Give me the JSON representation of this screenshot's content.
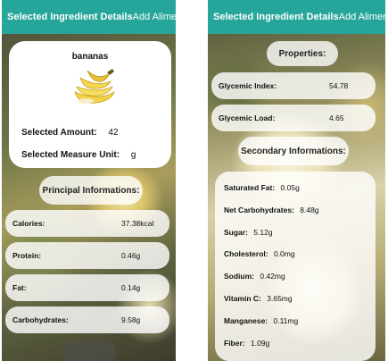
{
  "left_screen": {
    "appbar": {
      "title": "Selected Ingredient Details",
      "action": "Add Aliment"
    },
    "food": {
      "name": "bananas",
      "amount_label": "Selected Amount:",
      "amount_value": "42",
      "unit_label": "Selected Measure Unit:",
      "unit_value": "g"
    },
    "principal_header": "Principal Informations:",
    "principal_items": [
      {
        "label": "Calories:",
        "value": "37.38kcal"
      },
      {
        "label": "Protein:",
        "value": "0.46g"
      },
      {
        "label": "Fat:",
        "value": "0.14g"
      },
      {
        "label": "Carbohydrates:",
        "value": "9.58g"
      }
    ]
  },
  "right_screen": {
    "appbar": {
      "title": "Selected Ingredient Details",
      "action": "Add Aliment"
    },
    "properties_header": "Properties:",
    "properties": [
      {
        "label": "Glycemic Index:",
        "value": "54.78"
      },
      {
        "label": "Glycemic Load:",
        "value": "4.65"
      }
    ],
    "secondary_header": "Secondary Informations:",
    "secondary_items": [
      {
        "label": "Saturated Fat:",
        "value": "0.05g"
      },
      {
        "label": "Net Carbohydrates:",
        "value": "8.48g"
      },
      {
        "label": "Sugar:",
        "value": "5.12g"
      },
      {
        "label": "Cholesterol:",
        "value": "0.0mg"
      },
      {
        "label": "Sodium:",
        "value": "0.42mg"
      },
      {
        "label": "Vitamin C:",
        "value": "3.65mg"
      },
      {
        "label": "Manganese:",
        "value": "0.11mg"
      },
      {
        "label": "Fiber:",
        "value": "1.09g"
      }
    ]
  },
  "colors": {
    "appbar": "#26a69a",
    "card": "#ffffff"
  },
  "icons": {
    "food_image": "banana-bunch-image"
  }
}
